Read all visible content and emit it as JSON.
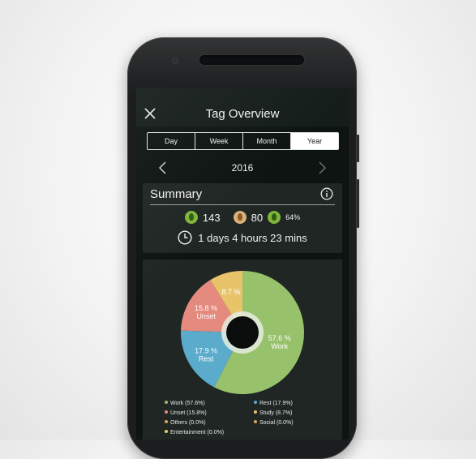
{
  "header": {
    "title": "Tag Overview"
  },
  "period_tabs": [
    {
      "label": "Day",
      "active": false
    },
    {
      "label": "Week",
      "active": false
    },
    {
      "label": "Month",
      "active": false
    },
    {
      "label": "Year",
      "active": true
    }
  ],
  "period": {
    "label": "2016"
  },
  "summary": {
    "title": "Summary",
    "healthy_trees": "143",
    "withered_trees": "80",
    "success_rate": "64%",
    "total_time": "1 days 4 hours 23 mins"
  },
  "colors": {
    "work": "#97c16a",
    "rest": "#5aabcc",
    "unset": "#e48a7e",
    "study": "#e7c46a",
    "others": "#e0a25a",
    "social": "#d8a458",
    "entertainment": "#e2cf63"
  },
  "chart_data": {
    "type": "pie",
    "slices": [
      {
        "key": "work",
        "value": 57.6,
        "label_pct": "57.6 %",
        "label_name": "Work"
      },
      {
        "key": "rest",
        "value": 17.9,
        "label_pct": "17.9 %",
        "label_name": "Rest"
      },
      {
        "key": "unset",
        "value": 15.8,
        "label_pct": "15.8 %",
        "label_name": "Unset"
      },
      {
        "key": "study",
        "value": 8.7,
        "label_pct": "8.7 %",
        "label_name": ""
      }
    ],
    "legend": [
      {
        "key": "work",
        "text": "Work (57.6%)"
      },
      {
        "key": "rest",
        "text": "Rest (17.9%)"
      },
      {
        "key": "unset",
        "text": "Unset (15.8%)"
      },
      {
        "key": "study",
        "text": "Study (8.7%)"
      },
      {
        "key": "others",
        "text": "Others (0.0%)"
      },
      {
        "key": "social",
        "text": "Social (0.0%)"
      },
      {
        "key": "entertainment",
        "text": "Entertainment (0.0%)"
      }
    ]
  }
}
